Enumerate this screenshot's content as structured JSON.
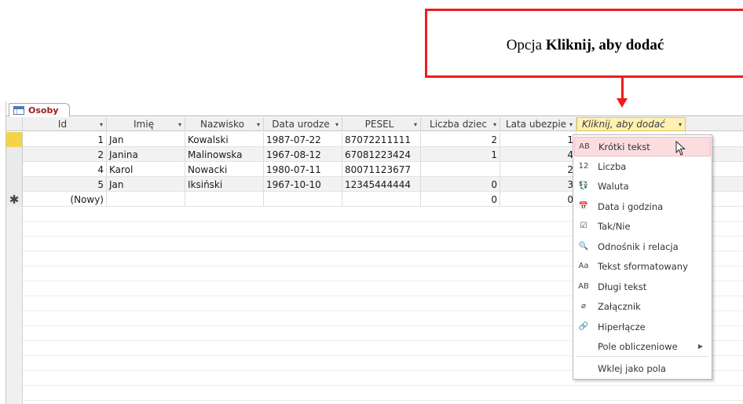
{
  "callout": {
    "prefix": "Opcja",
    "bold": "Kliknij, aby dodać",
    "color": "#ee1c1c"
  },
  "tab": {
    "label": "Osoby",
    "icon": "table-icon"
  },
  "columns": [
    {
      "key": "id",
      "label": "Id"
    },
    {
      "key": "imie",
      "label": "Imię"
    },
    {
      "key": "nazwisko",
      "label": "Nazwisko"
    },
    {
      "key": "data",
      "label": "Data urodze"
    },
    {
      "key": "pesel",
      "label": "PESEL"
    },
    {
      "key": "liczba",
      "label": "Liczba dziec"
    },
    {
      "key": "lata",
      "label": "Lata ubezpie"
    }
  ],
  "add_column": {
    "label": "Kliknij, aby dodać",
    "bg": "#fff1b4"
  },
  "rows": [
    {
      "id": "1",
      "imie": "Jan",
      "nazwisko": "Kowalski",
      "data": "1987-07-22",
      "pesel": "87072211111",
      "liczba": "2",
      "lata": "1"
    },
    {
      "id": "2",
      "imie": "Janina",
      "nazwisko": "Malinowska",
      "data": "1967-08-12",
      "pesel": "67081223424",
      "liczba": "1",
      "lata": "4"
    },
    {
      "id": "4",
      "imie": "Karol",
      "nazwisko": "Nowacki",
      "data": "1980-07-11",
      "pesel": "80071123677",
      "liczba": "",
      "lata": "2"
    },
    {
      "id": "5",
      "imie": "Jan",
      "nazwisko": "Iksiński",
      "data": "1967-10-10",
      "pesel": "12345444444",
      "liczba": "0",
      "lata": "3"
    }
  ],
  "new_row": {
    "marker": "✱",
    "id": "(Nowy)",
    "liczba": "0",
    "lata": "0"
  },
  "menu": [
    {
      "icon": "AB",
      "icon_name": "short-text-icon",
      "label": "Krótki tekst",
      "hover": true
    },
    {
      "icon": "12",
      "icon_name": "number-icon",
      "label": "Liczba"
    },
    {
      "icon": "💱",
      "icon_name": "currency-icon",
      "label": "Waluta"
    },
    {
      "icon": "📅",
      "icon_name": "date-time-icon",
      "label": "Data i godzina"
    },
    {
      "icon": "☑",
      "icon_name": "yes-no-icon",
      "label": "Tak/Nie"
    },
    {
      "icon": "🔍",
      "icon_name": "lookup-icon",
      "label": "Odnośnik i relacja"
    },
    {
      "icon": "Aa",
      "icon_name": "rich-text-icon",
      "label": "Tekst sformatowany"
    },
    {
      "icon": "AB",
      "icon_name": "long-text-icon",
      "label": "Długi tekst"
    },
    {
      "icon": "⌀",
      "icon_name": "attachment-icon",
      "label": "Załącznik"
    },
    {
      "icon": "🔗",
      "icon_name": "hyperlink-icon",
      "label": "Hiperłącze"
    },
    {
      "icon": "",
      "icon_name": "",
      "label": "Pole obliczeniowe",
      "submenu": true
    },
    {
      "icon": "",
      "icon_name": "",
      "label": "Wklej jako pola"
    }
  ]
}
